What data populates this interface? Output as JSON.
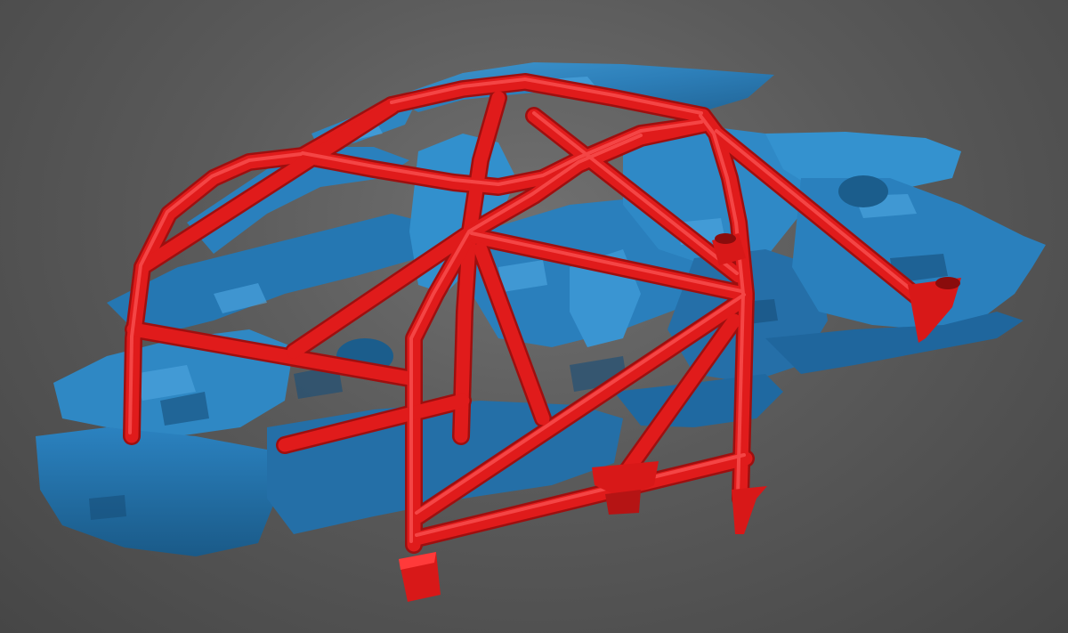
{
  "scene": {
    "subject": "roll-cage-fitted-to-3d-scanned-car-body",
    "colors": {
      "background": "#5a5a5a",
      "body_scan": "#2e86c1",
      "body_scan_shadow": "#1c5f8e",
      "body_scan_highlight": "#4aa3dd",
      "cage_tube": "#e01b1b",
      "cage_tube_shadow": "#9e0f0f",
      "cage_tube_highlight": "#ff4a4a"
    }
  }
}
